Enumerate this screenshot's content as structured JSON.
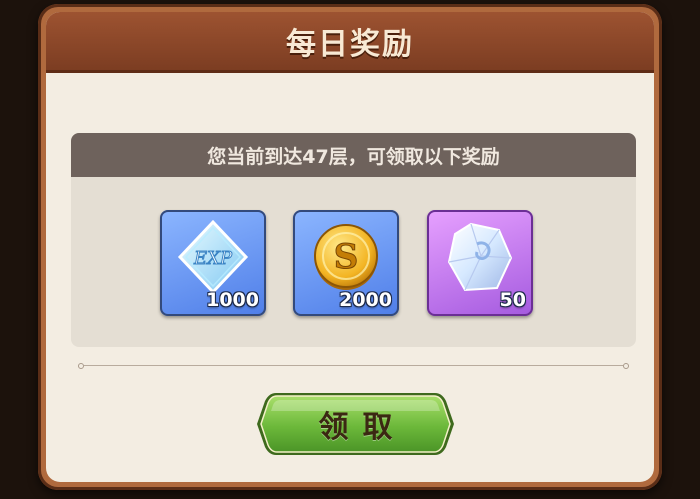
{
  "dialog": {
    "title": "每日奖励",
    "message": "您当前到达47层，可领取以下奖励",
    "rewards": [
      {
        "icon": "exp-crystal-icon",
        "quantity": "1000"
      },
      {
        "icon": "gold-coin-icon",
        "quantity": "2000"
      },
      {
        "icon": "purple-gem-icon",
        "quantity": "50"
      }
    ],
    "claim_label": "领取"
  },
  "colors": {
    "title_bar": "#8e4a2b",
    "panel_header": "#6e625c",
    "claim_button": "#6fb83e",
    "tile_blue": "#5f8ff0",
    "tile_purple": "#b66ae8"
  }
}
